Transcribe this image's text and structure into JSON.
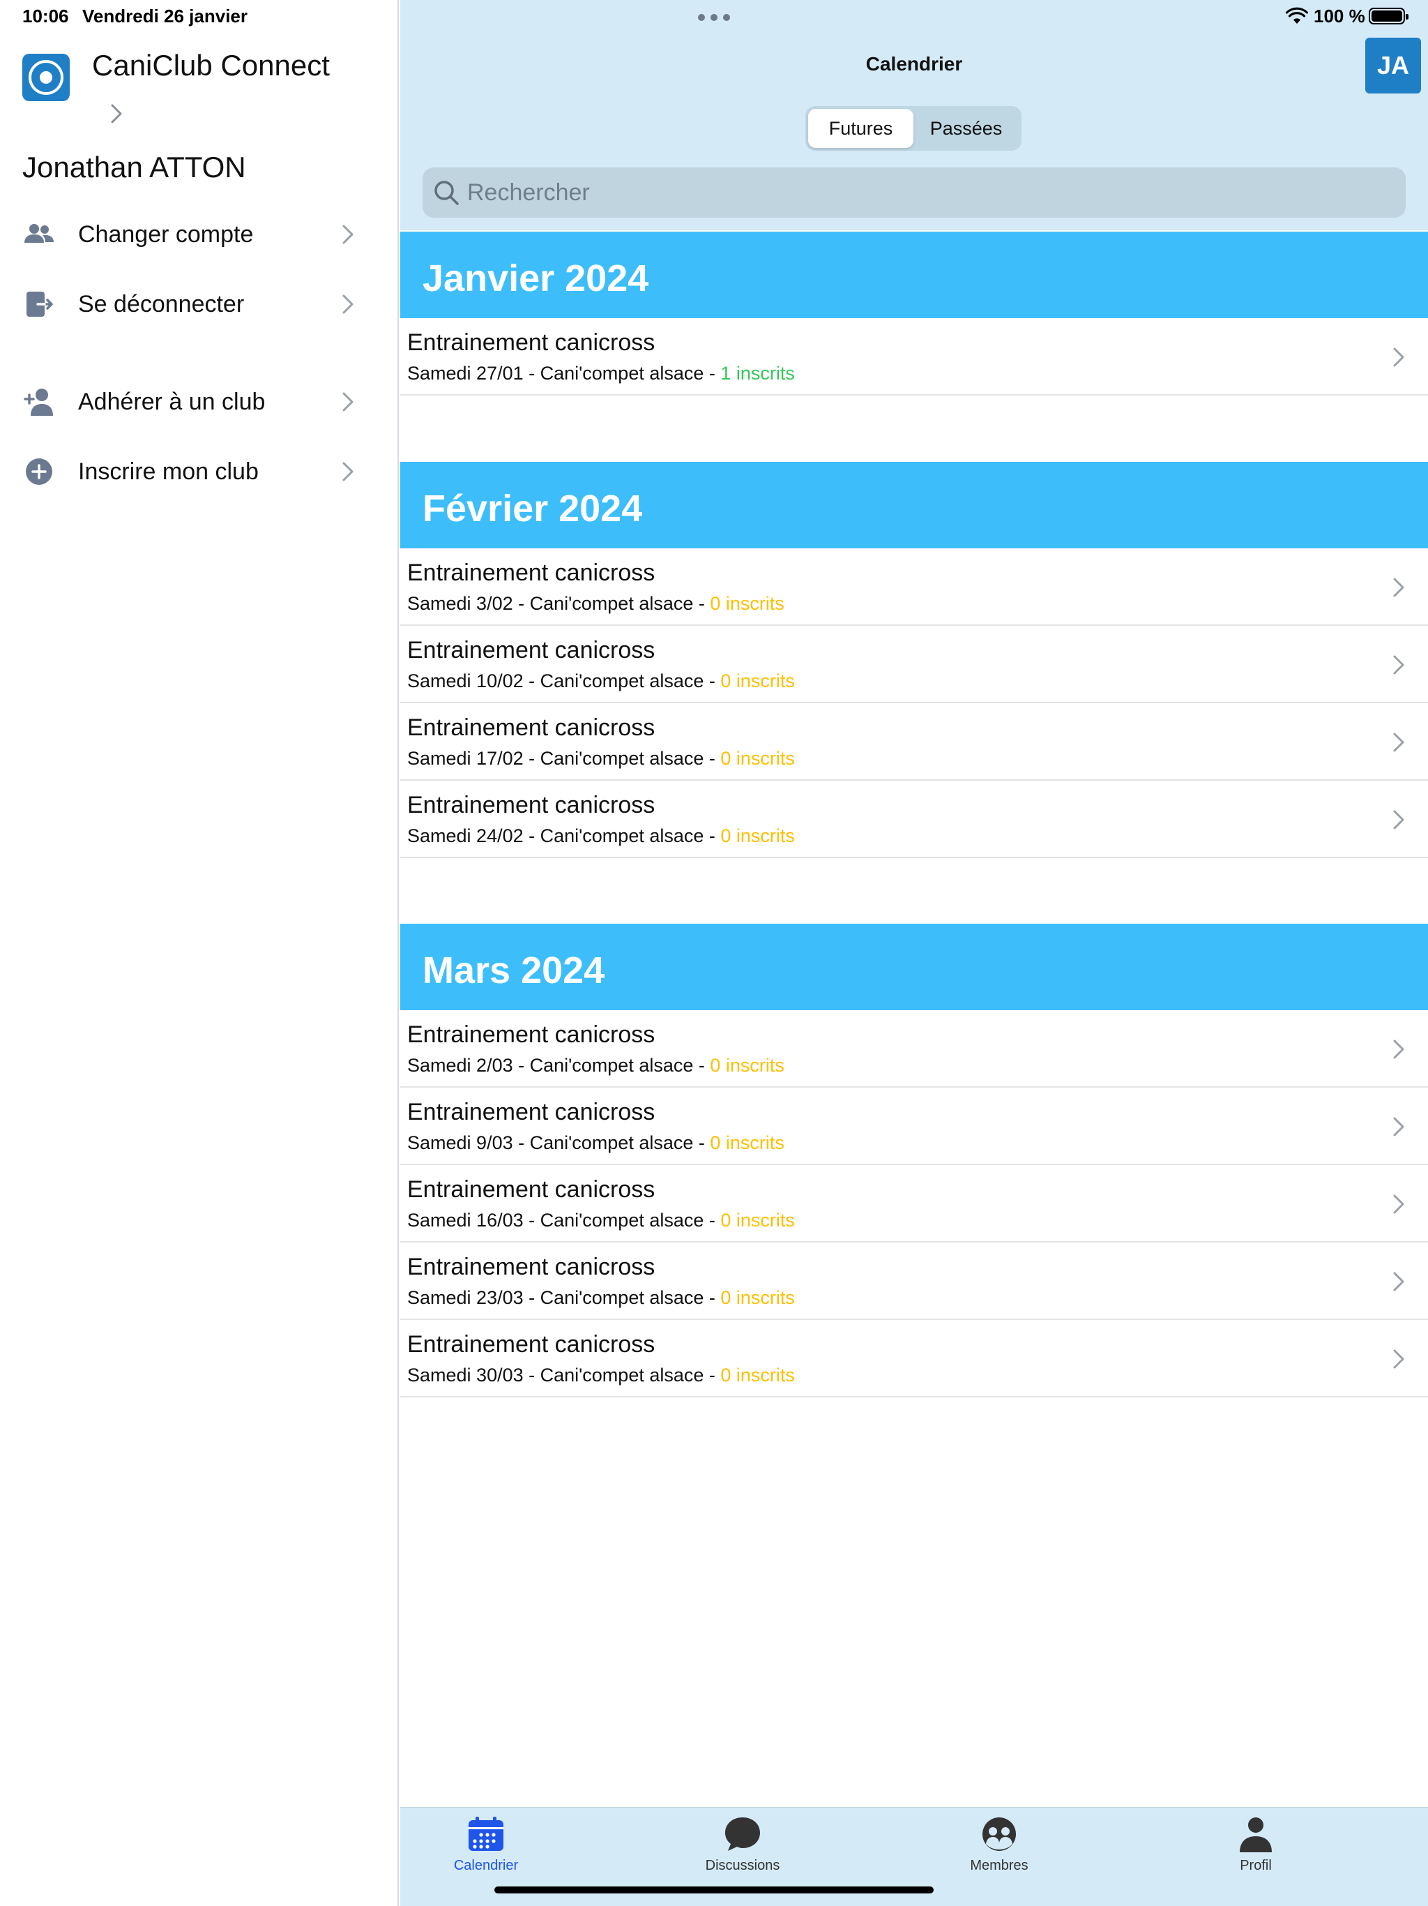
{
  "status_bar": {
    "time": "10:06",
    "date": "Vendredi 26 janvier",
    "battery": "100 %"
  },
  "sidebar": {
    "app_name": "CaniClub Connect",
    "user_name": "Jonathan ATTON",
    "items": [
      {
        "label": "Changer compte",
        "icon": "people-icon"
      },
      {
        "label": "Se déconnecter",
        "icon": "logout-icon"
      },
      {
        "label": "Adhérer à un club",
        "icon": "add-person-icon"
      },
      {
        "label": "Inscrire mon club",
        "icon": "plus-circle-icon"
      }
    ]
  },
  "header": {
    "title": "Calendrier",
    "avatar": "JA",
    "segments": [
      {
        "label": "Futures",
        "active": true
      },
      {
        "label": "Passées",
        "active": false
      }
    ],
    "search": {
      "placeholder": "Rechercher",
      "value": ""
    }
  },
  "colors": {
    "accent": "#1f7fc6",
    "month_header": "#3dbefb",
    "header_bg": "#d4eaf7",
    "count_green": "#34c759",
    "count_yellow": "#ffbf00",
    "tab_active": "#1f55e8"
  },
  "months": [
    {
      "title": "Janvier 2024",
      "events": [
        {
          "title": "Entrainement canicross",
          "subtitle": "Samedi 27/01 - Cani'compet alsace - ",
          "count": "1 inscrits",
          "status": "green"
        }
      ]
    },
    {
      "title": "Février 2024",
      "events": [
        {
          "title": "Entrainement canicross",
          "subtitle": "Samedi 3/02 - Cani'compet alsace - ",
          "count": "0 inscrits",
          "status": "yellow"
        },
        {
          "title": "Entrainement canicross",
          "subtitle": "Samedi 10/02 - Cani'compet alsace - ",
          "count": "0 inscrits",
          "status": "yellow"
        },
        {
          "title": "Entrainement canicross",
          "subtitle": "Samedi 17/02 - Cani'compet alsace - ",
          "count": "0 inscrits",
          "status": "yellow"
        },
        {
          "title": "Entrainement canicross",
          "subtitle": "Samedi 24/02 - Cani'compet alsace - ",
          "count": "0 inscrits",
          "status": "yellow"
        }
      ]
    },
    {
      "title": "Mars 2024",
      "events": [
        {
          "title": "Entrainement canicross",
          "subtitle": "Samedi 2/03 - Cani'compet alsace - ",
          "count": "0 inscrits",
          "status": "yellow"
        },
        {
          "title": "Entrainement canicross",
          "subtitle": "Samedi 9/03 - Cani'compet alsace - ",
          "count": "0 inscrits",
          "status": "yellow"
        },
        {
          "title": "Entrainement canicross",
          "subtitle": "Samedi 16/03 - Cani'compet alsace - ",
          "count": "0 inscrits",
          "status": "yellow"
        },
        {
          "title": "Entrainement canicross",
          "subtitle": "Samedi 23/03 - Cani'compet alsace - ",
          "count": "0 inscrits",
          "status": "yellow"
        },
        {
          "title": "Entrainement canicross",
          "subtitle": "Samedi 30/03 - Cani'compet alsace - ",
          "count": "0 inscrits",
          "status": "yellow"
        }
      ]
    }
  ],
  "tabbar": [
    {
      "label": "Calendrier",
      "icon": "calendar-icon",
      "active": true
    },
    {
      "label": "Discussions",
      "icon": "chat-bubble-icon",
      "active": false
    },
    {
      "label": "Membres",
      "icon": "members-icon",
      "active": false
    },
    {
      "label": "Profil",
      "icon": "person-icon",
      "active": false
    }
  ]
}
